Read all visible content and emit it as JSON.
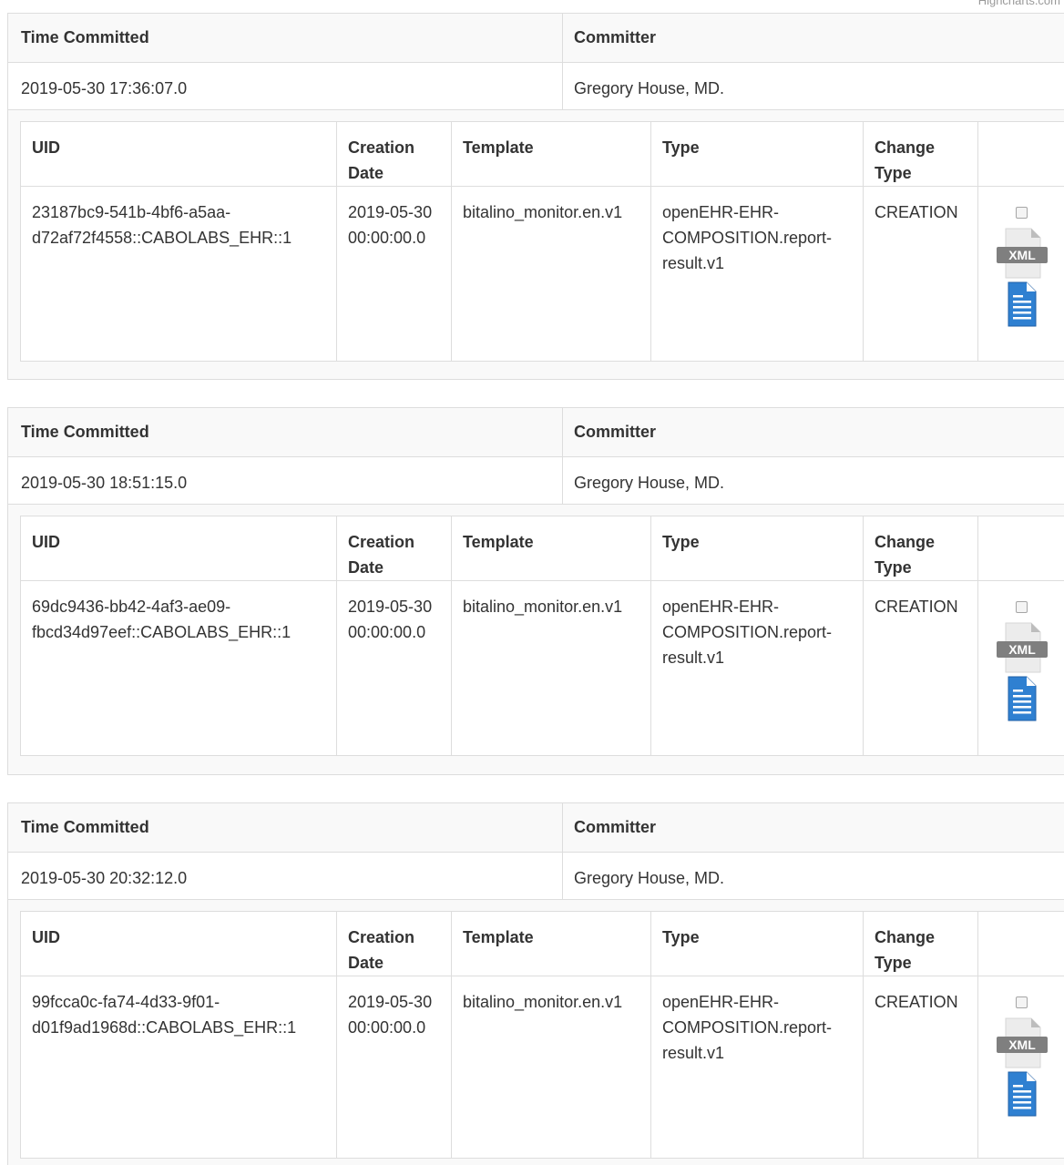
{
  "credit": "Highcharts.com",
  "headers": {
    "time_committed": "Time Committed",
    "committer": "Committer",
    "uid": "UID",
    "creation_date": "Creation Date",
    "template": "Template",
    "type": "Type",
    "change_type": "Change Type"
  },
  "icons": {
    "xml_label": "XML",
    "xml_icon": "xml-file-icon",
    "doc_icon": "document-icon",
    "doc_color": "#2f80d1"
  },
  "contributions": [
    {
      "time_committed": "2019-05-30 17:36:07.0",
      "committer": "Gregory House, MD.",
      "version": {
        "uid": "23187bc9-541b-4bf6-a5aa-d72af72f4558::CABOLABS_EHR::1",
        "creation_date": "2019-05-30 00:00:00.0",
        "template": "bitalino_monitor.en.v1",
        "type": "openEHR-EHR-COMPOSITION.report-result.v1",
        "change_type": "CREATION"
      }
    },
    {
      "time_committed": "2019-05-30 18:51:15.0",
      "committer": "Gregory House, MD.",
      "version": {
        "uid": "69dc9436-bb42-4af3-ae09-fbcd34d97eef::CABOLABS_EHR::1",
        "creation_date": "2019-05-30 00:00:00.0",
        "template": "bitalino_monitor.en.v1",
        "type": "openEHR-EHR-COMPOSITION.report-result.v1",
        "change_type": "CREATION"
      }
    },
    {
      "time_committed": "2019-05-30 20:32:12.0",
      "committer": "Gregory House, MD.",
      "version": {
        "uid": "99fcca0c-fa74-4d33-9f01-d01f9ad1968d::CABOLABS_EHR::1",
        "creation_date": "2019-05-30 00:00:00.0",
        "template": "bitalino_monitor.en.v1",
        "type": "openEHR-EHR-COMPOSITION.report-result.v1",
        "change_type": "CREATION"
      }
    }
  ]
}
